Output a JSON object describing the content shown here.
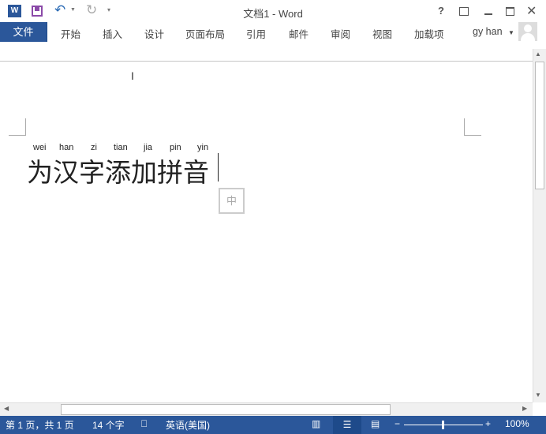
{
  "window": {
    "title": "文档1 - Word",
    "user": "gy han"
  },
  "ribbon": {
    "file_tab": "文件",
    "tabs": [
      "开始",
      "插入",
      "设计",
      "页面布局",
      "引用",
      "邮件",
      "审阅",
      "视图",
      "加载项"
    ]
  },
  "document": {
    "pinyin": [
      "wei",
      "han",
      "zi",
      "tian",
      "jia",
      "pin",
      "yin"
    ],
    "text": "为汉字添加拼音",
    "ime_indicator": "中"
  },
  "status": {
    "page": "第 1 页，共 1 页",
    "words": "14 个字",
    "language": "英语(美国)",
    "zoom": "100%",
    "zoom_fraction": 0.5
  },
  "colors": {
    "accent": "#2b579a"
  }
}
